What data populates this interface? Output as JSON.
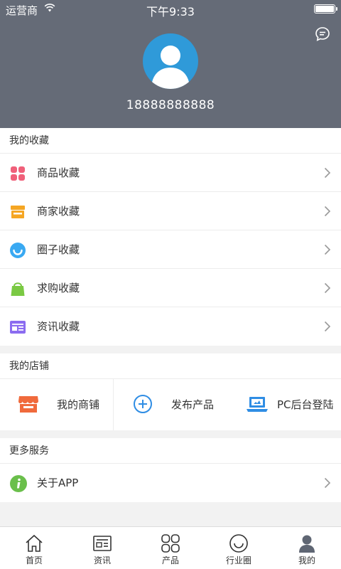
{
  "status": {
    "carrier": "运营商",
    "time": "下午9:33",
    "battery_level": 1.0
  },
  "profile": {
    "phone": "18888888888"
  },
  "favorites": {
    "title": "我的收藏",
    "items": [
      {
        "label": "商品收藏",
        "icon": "goods-icon",
        "color": "#f0607a"
      },
      {
        "label": "商家收藏",
        "icon": "shop-icon",
        "color": "#f5a623"
      },
      {
        "label": "圈子收藏",
        "icon": "circle-icon",
        "color": "#39a9f2"
      },
      {
        "label": "求购收藏",
        "icon": "bag-icon",
        "color": "#7ac943"
      },
      {
        "label": "资讯收藏",
        "icon": "news-icon",
        "color": "#8b6cf0"
      }
    ]
  },
  "my_shop": {
    "title": "我的店铺",
    "items": [
      {
        "label": "我的商铺",
        "icon": "store-icon",
        "color": "#f06a3c"
      },
      {
        "label": "发布产品",
        "icon": "add-circle-icon",
        "color": "#2f8de4"
      },
      {
        "label": "PC后台登陆",
        "icon": "laptop-icon",
        "color": "#2f8de4"
      }
    ]
  },
  "more": {
    "title": "更多服务",
    "items": [
      {
        "label": "关于APP",
        "icon": "info-icon",
        "color": "#6abf4b"
      }
    ]
  },
  "tabbar": {
    "tabs": [
      {
        "label": "首页",
        "icon": "home-icon"
      },
      {
        "label": "资讯",
        "icon": "news-tab-icon"
      },
      {
        "label": "产品",
        "icon": "product-tab-icon"
      },
      {
        "label": "行业圈",
        "icon": "smile-tab-icon"
      },
      {
        "label": "我的",
        "icon": "user-tab-icon",
        "active": true
      }
    ]
  },
  "colors": {
    "header_bg": "#656b77",
    "avatar_bg": "#2f9ad9",
    "page_bg": "#f2f2f2"
  }
}
